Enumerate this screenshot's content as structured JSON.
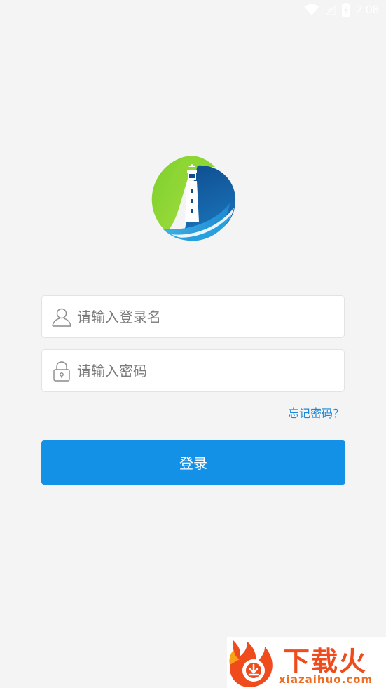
{
  "status_bar": {
    "time": "2:08",
    "icons": [
      "wifi-icon",
      "no-signal-icon",
      "battery-charging-icon"
    ]
  },
  "login": {
    "username_placeholder": "请输入登录名",
    "password_placeholder": "请输入密码",
    "forgot_password": "忘记密码？",
    "login_button": "登录"
  },
  "watermark": {
    "brand": "下载火",
    "url": "xiazaihuo.com"
  },
  "colors": {
    "background": "#f4f4f4",
    "primary": "#1391e6",
    "link": "#1b87d8",
    "logo_green": "#8ad432",
    "logo_blue": "#115a9d",
    "watermark_orange": "#ef4b1c"
  }
}
